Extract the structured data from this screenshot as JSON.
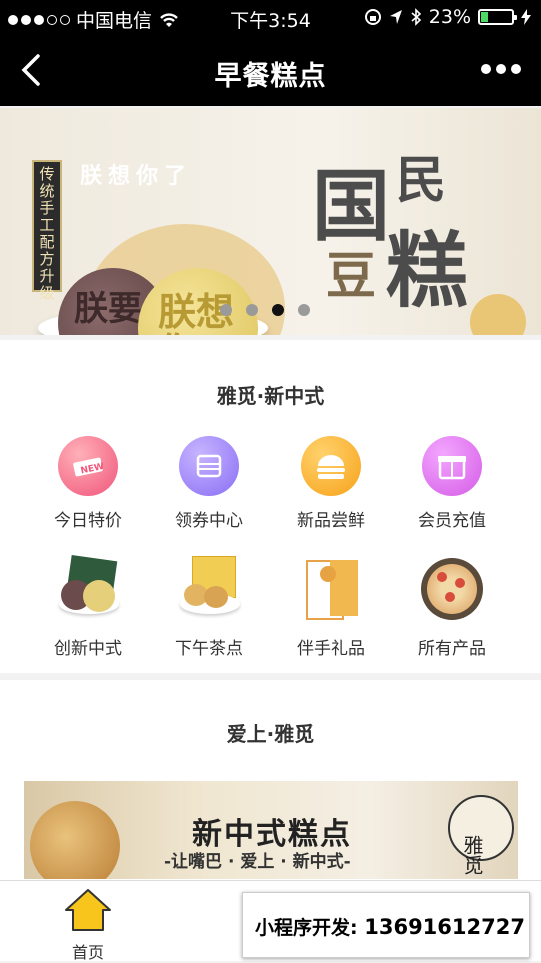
{
  "status_bar": {
    "carrier": "中国电信",
    "time": "下午3:54",
    "battery": "23%"
  },
  "nav": {
    "title": "早餐糕点"
  },
  "banner": {
    "side_text": "传统手工 配方升级",
    "headline": "朕想你了",
    "cake_text_1": "朕要",
    "cake_text_2": "朕想你",
    "big_title_1": "国",
    "big_title_2": "民",
    "big_title_3": "豆",
    "big_title_4": "糕",
    "pages": 4,
    "active_page": 3
  },
  "section1": {
    "title": "雅觅·新中式",
    "items": [
      {
        "label": "今日特价",
        "icon": "new-tag-icon",
        "color": "#f0557a"
      },
      {
        "label": "领券中心",
        "icon": "coupon-icon",
        "color": "#8a6ef5"
      },
      {
        "label": "新品尝鲜",
        "icon": "burger-icon",
        "color": "#f7a21b"
      },
      {
        "label": "会员充值",
        "icon": "gift-icon",
        "color": "#d55ce6"
      },
      {
        "label": "创新中式",
        "icon": "mooncake-box-image"
      },
      {
        "label": "下午茶点",
        "icon": "pastry-box-image"
      },
      {
        "label": "伴手礼品",
        "icon": "gift-card-image"
      },
      {
        "label": "所有产品",
        "icon": "cookie-plate-image"
      }
    ]
  },
  "section2": {
    "title": "爱上·雅觅",
    "promo_title": "新中式糕点",
    "promo_sub": "-让嘴巴 · 爱上 · 新中式-",
    "promo_badge": "雅觅"
  },
  "tabbar": {
    "home_label": "首页"
  },
  "ad": {
    "label": "小程序开发:",
    "phone": "13691612727"
  }
}
